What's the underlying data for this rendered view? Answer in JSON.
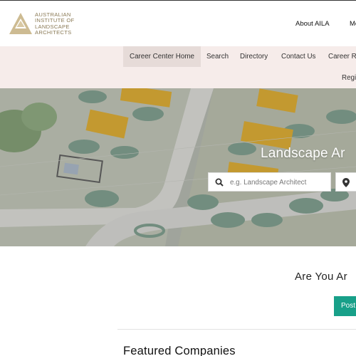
{
  "header": {
    "logo_lines": [
      "Australian",
      "Institute of",
      "Landscape",
      "Architects"
    ],
    "top_links": [
      {
        "label": "About AILA"
      },
      {
        "label": "Me"
      }
    ]
  },
  "nav": {
    "items": [
      {
        "label": "Career Center Home",
        "active": true
      },
      {
        "label": "Search"
      },
      {
        "label": "Directory"
      },
      {
        "label": "Contact Us"
      },
      {
        "label": "Career Re"
      },
      {
        "label": "Regi"
      }
    ]
  },
  "hero": {
    "title": "Landscape Ar",
    "search": {
      "placeholder": "e.g. Landscape Architect"
    },
    "search_icon": "search-icon",
    "location_icon": "map-pin-icon"
  },
  "main": {
    "prompt": "Are You Ar",
    "post_button_label": "Post",
    "featured_heading": "Featured Companies"
  },
  "colors": {
    "logo_gold": "#c9b892",
    "nav_bg": "#f6ecea",
    "nav_active_bg": "#e6dbd8",
    "accent_green": "#18a089"
  }
}
